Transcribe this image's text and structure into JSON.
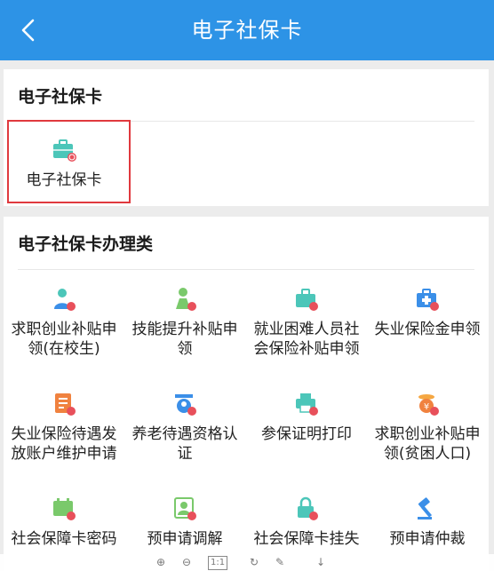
{
  "header": {
    "title": "电子社保卡",
    "back_icon": "chevron-left-icon"
  },
  "section1": {
    "title": "电子社保卡",
    "items": [
      {
        "label": "电子社保卡",
        "icon": "card-bag-icon"
      }
    ]
  },
  "section2": {
    "title": "电子社保卡办理类",
    "items": [
      {
        "label": "求职创业补贴申领(在校生)",
        "icon": "student-icon"
      },
      {
        "label": "技能提升补贴申领",
        "icon": "person-skill-icon"
      },
      {
        "label": "就业困难人员社会保险补贴申领",
        "icon": "briefcase-icon"
      },
      {
        "label": "失业保险金申领",
        "icon": "medical-kit-icon"
      },
      {
        "label": "失业保险待遇发放账户维护申请",
        "icon": "document-icon"
      },
      {
        "label": "养老待遇资格认证",
        "icon": "face-scan-icon"
      },
      {
        "label": "参保证明打印",
        "icon": "printer-icon"
      },
      {
        "label": "求职创业补贴申领(贫困人口)",
        "icon": "coin-icon"
      },
      {
        "label": "社会保障卡密码",
        "icon": "calendar-card-icon"
      },
      {
        "label": "预申请调解",
        "icon": "profile-card-icon"
      },
      {
        "label": "社会保障卡挂失",
        "icon": "lock-icon"
      },
      {
        "label": "预申请仲裁",
        "icon": "gavel-icon"
      }
    ]
  },
  "bottombar": {
    "zoom_reset": "1:1"
  },
  "colors": {
    "header": "#2d93e6",
    "highlight": "#e0393e",
    "teal": "#4cc6b9",
    "blue": "#3b8fe8",
    "orange": "#f0823f"
  }
}
